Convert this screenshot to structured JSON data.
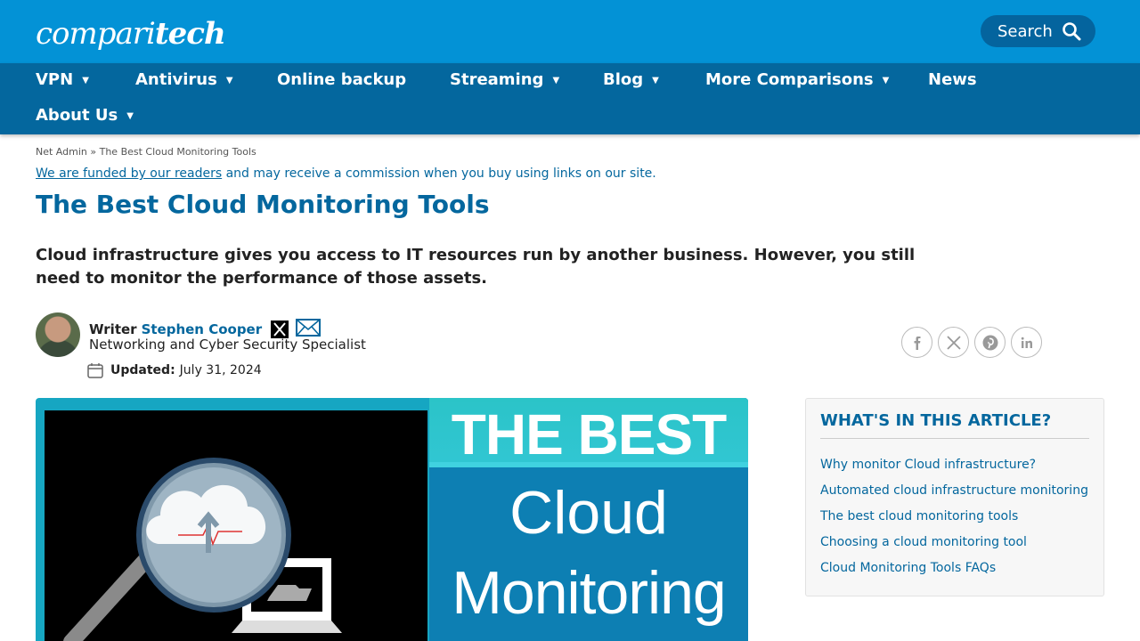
{
  "header": {
    "logo_light": "compari",
    "logo_bold": "tech",
    "search_label": "Search"
  },
  "nav": {
    "items": [
      {
        "label": "VPN",
        "has_caret": true
      },
      {
        "label": "Antivirus",
        "has_caret": true
      },
      {
        "label": "Online backup",
        "has_caret": false
      },
      {
        "label": "Streaming",
        "has_caret": true
      },
      {
        "label": "Blog",
        "has_caret": true
      },
      {
        "label": "More Comparisons",
        "has_caret": true
      },
      {
        "label": "News",
        "has_caret": false
      },
      {
        "label": "About Us",
        "has_caret": true
      }
    ],
    "caret": "▼"
  },
  "breadcrumb": {
    "parent": "Net Admin",
    "separator": "»",
    "current": "The Best Cloud Monitoring Tools"
  },
  "disclosure": {
    "link": "We are funded by our readers",
    "rest": " and may receive a commission when you buy using links on our site."
  },
  "article": {
    "title": "The Best Cloud Monitoring Tools",
    "lead": "Cloud infrastructure gives you access to IT resources run by another business. However, you still need to monitor the performance of those assets."
  },
  "author": {
    "writer_label": "Writer",
    "name": "Stephen Cooper",
    "role": "Networking and Cyber Security Specialist",
    "updated_label": "Updated:",
    "updated_date": "July 31, 2024"
  },
  "share": {
    "icons": [
      "facebook-icon",
      "x-icon",
      "pinterest-icon",
      "linkedin-icon"
    ]
  },
  "hero": {
    "line1": "THE BEST",
    "line2": "Cloud",
    "line3": "Monitoring"
  },
  "toc": {
    "title": "WHAT'S IN THIS ARTICLE?",
    "items": [
      "Why monitor Cloud infrastructure?",
      "Automated cloud infrastructure monitoring",
      "The best cloud monitoring tools",
      "Choosing a cloud monitoring tool",
      "Cloud Monitoring Tools FAQs"
    ]
  },
  "colors": {
    "brand_blue": "#0392d6",
    "nav_blue": "#04679e",
    "link_blue": "#04679e"
  }
}
